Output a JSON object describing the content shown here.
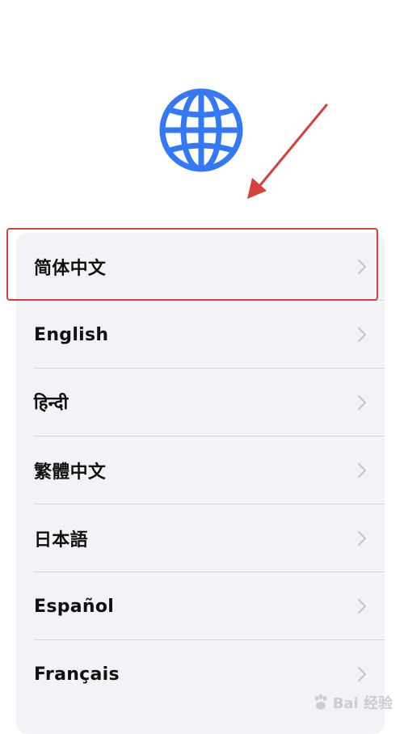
{
  "colors": {
    "globe_blue": "#3478f6",
    "list_bg": "#f2f2f7",
    "divider": "#d4d4d9",
    "chevron": "#c4c4c9",
    "annotation_red": "#d6403a",
    "label_text": "#111111"
  },
  "header": {
    "icon": "globe-icon"
  },
  "languages": [
    {
      "label": "简体中文"
    },
    {
      "label": "English"
    },
    {
      "label": "हिन्दी"
    },
    {
      "label": "繁體中文"
    },
    {
      "label": "日本語"
    },
    {
      "label": "Español"
    },
    {
      "label": "Français"
    }
  ],
  "annotation": {
    "arrow": "red-arrow",
    "highlight": "red-box"
  },
  "watermark": {
    "logo": "baidu-paw-icon",
    "text": "Bai 经验"
  }
}
